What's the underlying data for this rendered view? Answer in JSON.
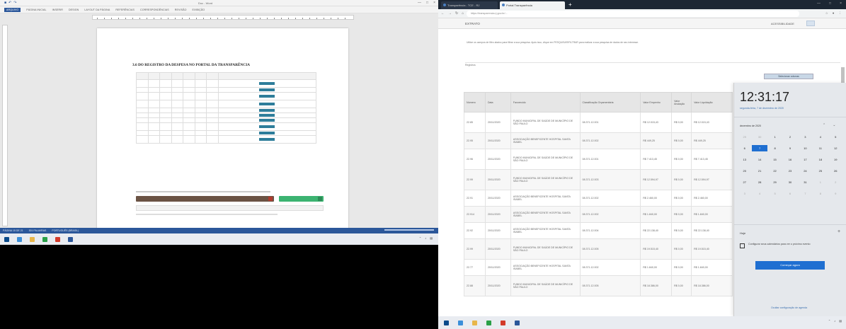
{
  "word": {
    "title": "Doc - Word",
    "tabs": [
      "ARQUIVO",
      "PÁGINA INICIAL",
      "INSERIR",
      "DESIGN",
      "LAYOUT DA PÁGINA",
      "REFERÊNCIAS",
      "CORRESPONDÊNCIAS",
      "REVISÃO",
      "EXIBIÇÃO"
    ],
    "heading": "3.6     DO REGISTRO DA DESPESA NO PORTAL DA TRANSPARÊNCIA",
    "status": [
      "PÁGINA 15 DE 21",
      "301 PALAVRAS",
      "PORTUGUÊS (BRASIL)"
    ]
  },
  "browser": {
    "tabs": [
      "Transparência - TCE - RJ",
      "Portal Transparência"
    ],
    "url": "https://transparencia.rj.gov.br/...",
    "page_header": "EXTRATO",
    "header_right": "ACESSIBILIDADE",
    "intro": "Utilize os campos de filtro abaixo para filtrar a sua pesquisa. Após isso, clique em PESQUISAR/FILTRAR para realizar a sua pesquisa de dados de seu interesse.",
    "filters_label": "Registros",
    "select_label": "Selecionar colunas"
  },
  "table": {
    "headers": [
      "Número",
      "Data",
      "Favorecido",
      "Classificação Orçamentária",
      "Valor Empenho",
      "Valor Anulação",
      "Valor Liquidação"
    ],
    "rows": [
      {
        "num": "22.85",
        "data": "20/11/2020",
        "fav": "FUNDO MUNICIPAL DE SAÚDE DE MUNICÍPIO DE SÃO PAULO",
        "cls": "08.371.12.001",
        "emp": "R$ 12.015,43",
        "anu": "R$ 0,00",
        "liq": "R$ 12.015,43",
        "tall": true
      },
      {
        "num": "22.95",
        "data": "20/11/2020",
        "fav": "ASSOCIAÇÃO BENEFICENTE HOSPITAL SANTA ISABEL",
        "cls": "08.371.12.002",
        "emp": "R$ 449,25",
        "anu": "R$ 0,00",
        "liq": "R$ 449,25",
        "tall": false
      },
      {
        "num": "22.96",
        "data": "20/11/2020",
        "fav": "FUNDO MUNICIPAL DE SAÚDE DE MUNICÍPIO DE SÃO PAULO",
        "cls": "08.371.12.001",
        "emp": "R$ 7.413,45",
        "anu": "R$ 0,00",
        "liq": "R$ 7.413,45",
        "tall": true
      },
      {
        "num": "22.99",
        "data": "20/11/2020",
        "fav": "FUNDO MUNICIPAL DE SAÚDE DE MUNICÍPIO DE SÃO PAULO",
        "cls": "08.371.12.003",
        "emp": "R$ 12.594,97",
        "anu": "R$ 0,00",
        "liq": "R$ 12.594,97",
        "tall": true
      },
      {
        "num": "22.91",
        "data": "20/11/2020",
        "fav": "ASSOCIAÇÃO BENEFICENTE HOSPITAL SANTA ISABEL",
        "cls": "08.371.12.002",
        "emp": "R$ 2.460,00",
        "anu": "R$ 0,00",
        "liq": "R$ 2.460,00",
        "tall": false
      },
      {
        "num": "22.914",
        "data": "20/11/2020",
        "fav": "ASSOCIAÇÃO BENEFICENTE HOSPITAL SANTA ISABEL",
        "cls": "08.371.12.002",
        "emp": "R$ 1.840,00",
        "anu": "R$ 0,00",
        "liq": "R$ 1.840,00",
        "tall": false
      },
      {
        "num": "22.92",
        "data": "20/11/2020",
        "fav": "ASSOCIAÇÃO BENEFICENTE HOSPITAL SANTA ISABEL",
        "cls": "08.371.12.004",
        "emp": "R$ 22.138,40",
        "anu": "R$ 0,00",
        "liq": "R$ 22.138,40",
        "tall": false
      },
      {
        "num": "22.99",
        "data": "20/11/2020",
        "fav": "FUNDO MUNICIPAL DE SAÚDE DE MUNICÍPIO DE SÃO PAULO",
        "cls": "08.371.12.005",
        "emp": "R$ 19.515,40",
        "anu": "R$ 0,00",
        "liq": "R$ 19.515,40",
        "tall": true
      },
      {
        "num": "22.77",
        "data": "20/11/2020",
        "fav": "ASSOCIAÇÃO BENEFICENTE HOSPITAL SANTA ISABEL",
        "cls": "08.371.12.002",
        "emp": "R$ 1.840,00",
        "anu": "R$ 0,00",
        "liq": "R$ 1.840,00",
        "tall": false
      },
      {
        "num": "22.88",
        "data": "20/11/2020",
        "fav": "FUNDO MUNICIPAL DE SAÚDE DE MUNICÍPIO DE SÃO PAULO",
        "cls": "08.371.12.005",
        "emp": "R$ 18.386,00",
        "anu": "R$ 0,00",
        "liq": "R$ 18.386,00",
        "tall": true
      }
    ]
  },
  "calendar": {
    "time": "12:31:17",
    "date": "segunda-feira, 7 de dezembro de 2020",
    "month": "dezembro de 2020",
    "days": [
      "29",
      "30",
      "1",
      "2",
      "3",
      "4",
      "5",
      "6",
      "7",
      "8",
      "9",
      "10",
      "11",
      "12",
      "13",
      "14",
      "15",
      "16",
      "17",
      "18",
      "19",
      "20",
      "21",
      "22",
      "23",
      "24",
      "25",
      "26",
      "27",
      "28",
      "29",
      "30",
      "31",
      "1",
      "2",
      "3",
      "4",
      "5",
      "6",
      "7",
      "8",
      "9"
    ],
    "today_index": 8,
    "agenda_label": "Hoje",
    "agenda_text": "Configurar seus calendários para ver o próximo evento",
    "agenda_button": "Começar agora",
    "config_link": "Ocultar configuração de agenda"
  },
  "colors": {
    "word_blue": "#2b579a",
    "accent": "#1f6fd1",
    "brown": "#6b5344",
    "green": "#3cb371"
  }
}
